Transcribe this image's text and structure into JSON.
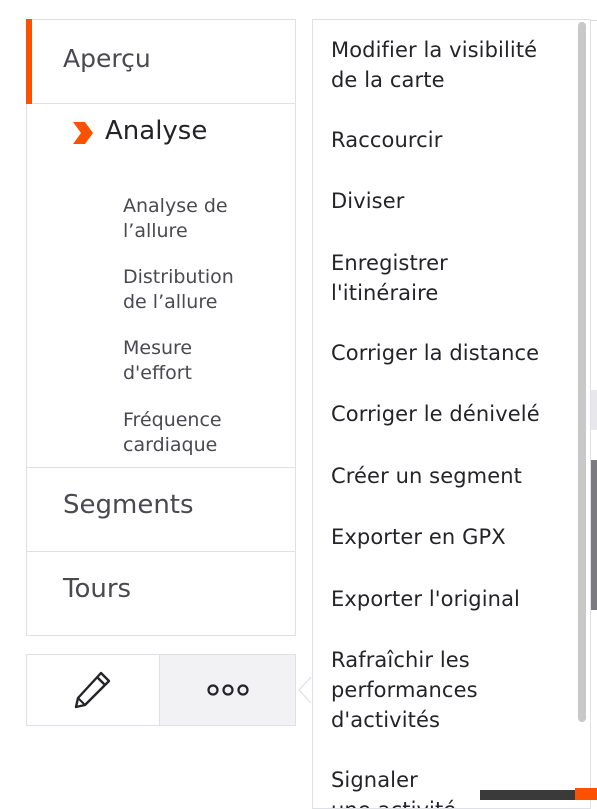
{
  "nav": {
    "overview_label": "Aperçu",
    "analysis_label": "Analyse",
    "analysis_subitems": [
      {
        "line1": "Analyse de",
        "line2": "l’allure"
      },
      {
        "line1": "Distribution",
        "line2": "de l’allure"
      },
      {
        "line1": "Mesure",
        "line2": "d'effort"
      },
      {
        "line1": "Fréquence",
        "line2": "cardiaque"
      }
    ],
    "segments_label": "Segments",
    "tours_label": "Tours"
  },
  "actions": {
    "edit_icon": "pencil-icon",
    "more_icon": "more-horizontal-icon",
    "more_label": "ooo"
  },
  "menu": {
    "items": [
      {
        "line1": "Modifier la visibilité",
        "line2": "de la carte"
      },
      {
        "line1": "Raccourcir"
      },
      {
        "line1": "Diviser"
      },
      {
        "line1": "Enregistrer",
        "line2": "l'itinéraire"
      },
      {
        "line1": "Corriger la distance"
      },
      {
        "line1": "Corriger le dénivelé"
      },
      {
        "line1": "Créer un segment"
      },
      {
        "line1": "Exporter en GPX"
      },
      {
        "line1": "Exporter l'original"
      },
      {
        "line1": "Rafraîchir les",
        "line2": "performances",
        "line3": "d'activités"
      },
      {
        "line1": "Signaler",
        "line2": "une activité"
      }
    ]
  },
  "colors": {
    "accent": "#fc5200",
    "border": "#dfdfe8",
    "text": "#242428"
  }
}
